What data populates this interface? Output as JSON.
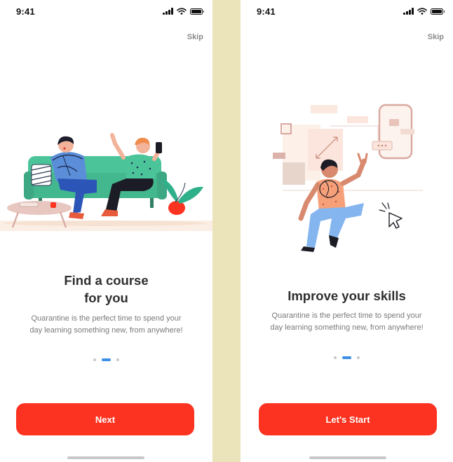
{
  "screens": [
    {
      "status_time": "9:41",
      "skip_label": "Skip",
      "title_line1": "Find a course",
      "title_line2": "for you",
      "description_line1": "Quarantine is the perfect time to spend your",
      "description_line2": "day learning something new, from anywhere!",
      "button_label": "Next",
      "page_indicator": {
        "count": 3,
        "active_index": 1
      }
    },
    {
      "status_time": "9:41",
      "skip_label": "Skip",
      "title": "Improve your skills",
      "description_line1": "Quarantine is the perfect time to spend your",
      "description_line2": "day learning something new, from anywhere!",
      "button_label": "Let's Start",
      "page_indicator": {
        "count": 3,
        "active_index": 1
      }
    }
  ],
  "colors": {
    "background": "#ebe3ba",
    "accent": "#fc3320",
    "indicator_active": "#3f8fe6",
    "sofa": "#4cc49a"
  },
  "icons": [
    "signal-icon",
    "wifi-icon",
    "battery-icon"
  ]
}
